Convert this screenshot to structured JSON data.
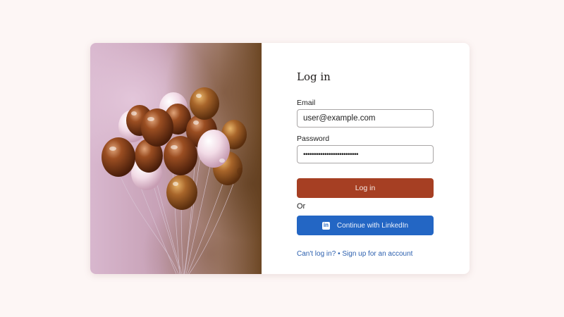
{
  "colors": {
    "background": "#fdf6f5",
    "card": "#ffffff",
    "primary_button": "#a63f23",
    "linkedin_button": "#2366c4",
    "link": "#2b5fae"
  },
  "hero": {
    "image_alt": "balloons"
  },
  "form": {
    "title": "Log in",
    "email_label": "Email",
    "email_value": "user@example.com",
    "password_label": "Password",
    "password_value": "••••••••••••••••••••••••••",
    "login_button": "Log in",
    "or_text": "Or",
    "linkedin_button": "Continue with LinkedIn",
    "linkedin_icon": "linkedin-icon",
    "cant_login_link": "Can't log in?",
    "separator": "•",
    "signup_link": "Sign up for an account"
  }
}
